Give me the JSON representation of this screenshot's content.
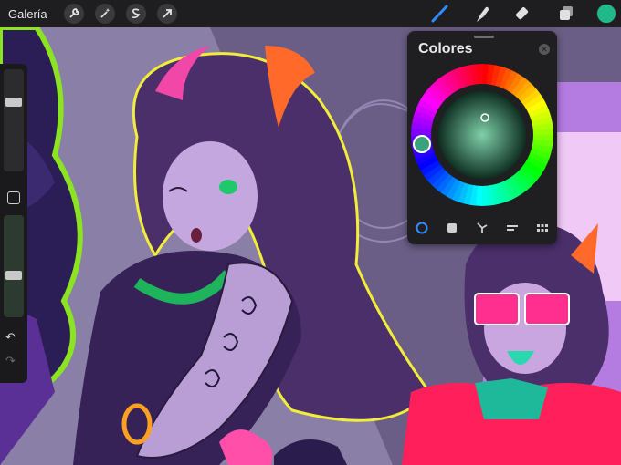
{
  "topbar": {
    "gallery_label": "Galería",
    "left_tools": [
      {
        "icon": "wrench-icon"
      },
      {
        "icon": "magic-wand-icon"
      },
      {
        "icon": "selection-icon"
      },
      {
        "icon": "transform-arrow-icon"
      }
    ],
    "right_tools": [
      {
        "icon": "brush-icon"
      },
      {
        "icon": "smudge-icon"
      },
      {
        "icon": "eraser-icon"
      },
      {
        "icon": "layers-icon"
      }
    ],
    "current_color": "#1fb98a"
  },
  "sidebar": {
    "brush_size_level": 0.3,
    "opacity_level": 0.6,
    "modify_icon": "square-icon",
    "undo_icon": "undo-icon",
    "redo_icon": "redo-icon",
    "undo_glyph": "↶",
    "redo_glyph": "↷"
  },
  "colors_panel": {
    "title": "Colores",
    "close_glyph": "✕",
    "selected_hue_color": "#3aa37d",
    "tabs": [
      {
        "icon": "disc-icon",
        "active": true
      },
      {
        "icon": "classic-icon",
        "active": false
      },
      {
        "icon": "harmony-icon",
        "active": false
      },
      {
        "icon": "value-icon",
        "active": false
      },
      {
        "icon": "palettes-icon",
        "active": false
      }
    ],
    "active_color": "#2f8cff"
  }
}
